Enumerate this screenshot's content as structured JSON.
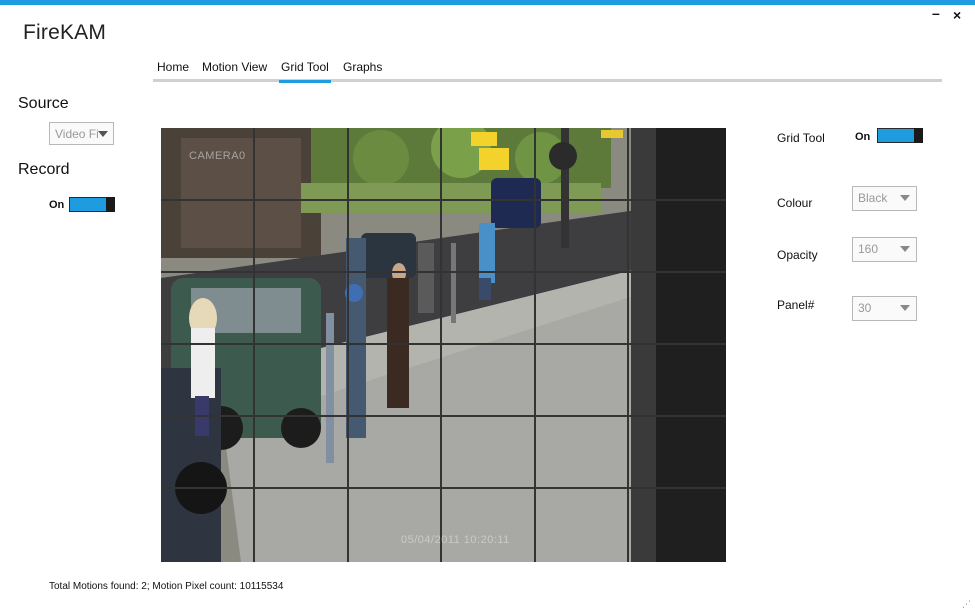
{
  "app": {
    "title": "FireKAM"
  },
  "window_controls": {
    "minimize_symbol": "–",
    "close_symbol": "×"
  },
  "tabs": [
    {
      "label": "Home"
    },
    {
      "label": "Motion View"
    },
    {
      "label": "Grid Tool",
      "active": true
    },
    {
      "label": "Graphs"
    }
  ],
  "left_panel": {
    "source_label": "Source",
    "source_select_value": "Video Fi",
    "record_label": "Record",
    "record_toggle_label": "On"
  },
  "video": {
    "camera_overlay": "CAMERA0",
    "timestamp_overlay": "05/04/2011 10:20:11",
    "grid": {
      "rows": 6,
      "cols": 6,
      "line_color": "#333333"
    }
  },
  "right_panel": {
    "grid_tool_label": "Grid Tool",
    "grid_tool_toggle_label": "On",
    "colour_label": "Colour",
    "colour_value": "Black",
    "opacity_label": "Opacity",
    "opacity_value": "160",
    "panel_label": "Panel#",
    "panel_value": "30"
  },
  "status_bar": {
    "text": "Total Motions found: 2; Motion Pixel count: 10115534"
  },
  "colors": {
    "accent": "#1f9be0",
    "tab_underline": "#d0d0d0",
    "toggle_thumb": "#1a1a1a"
  }
}
